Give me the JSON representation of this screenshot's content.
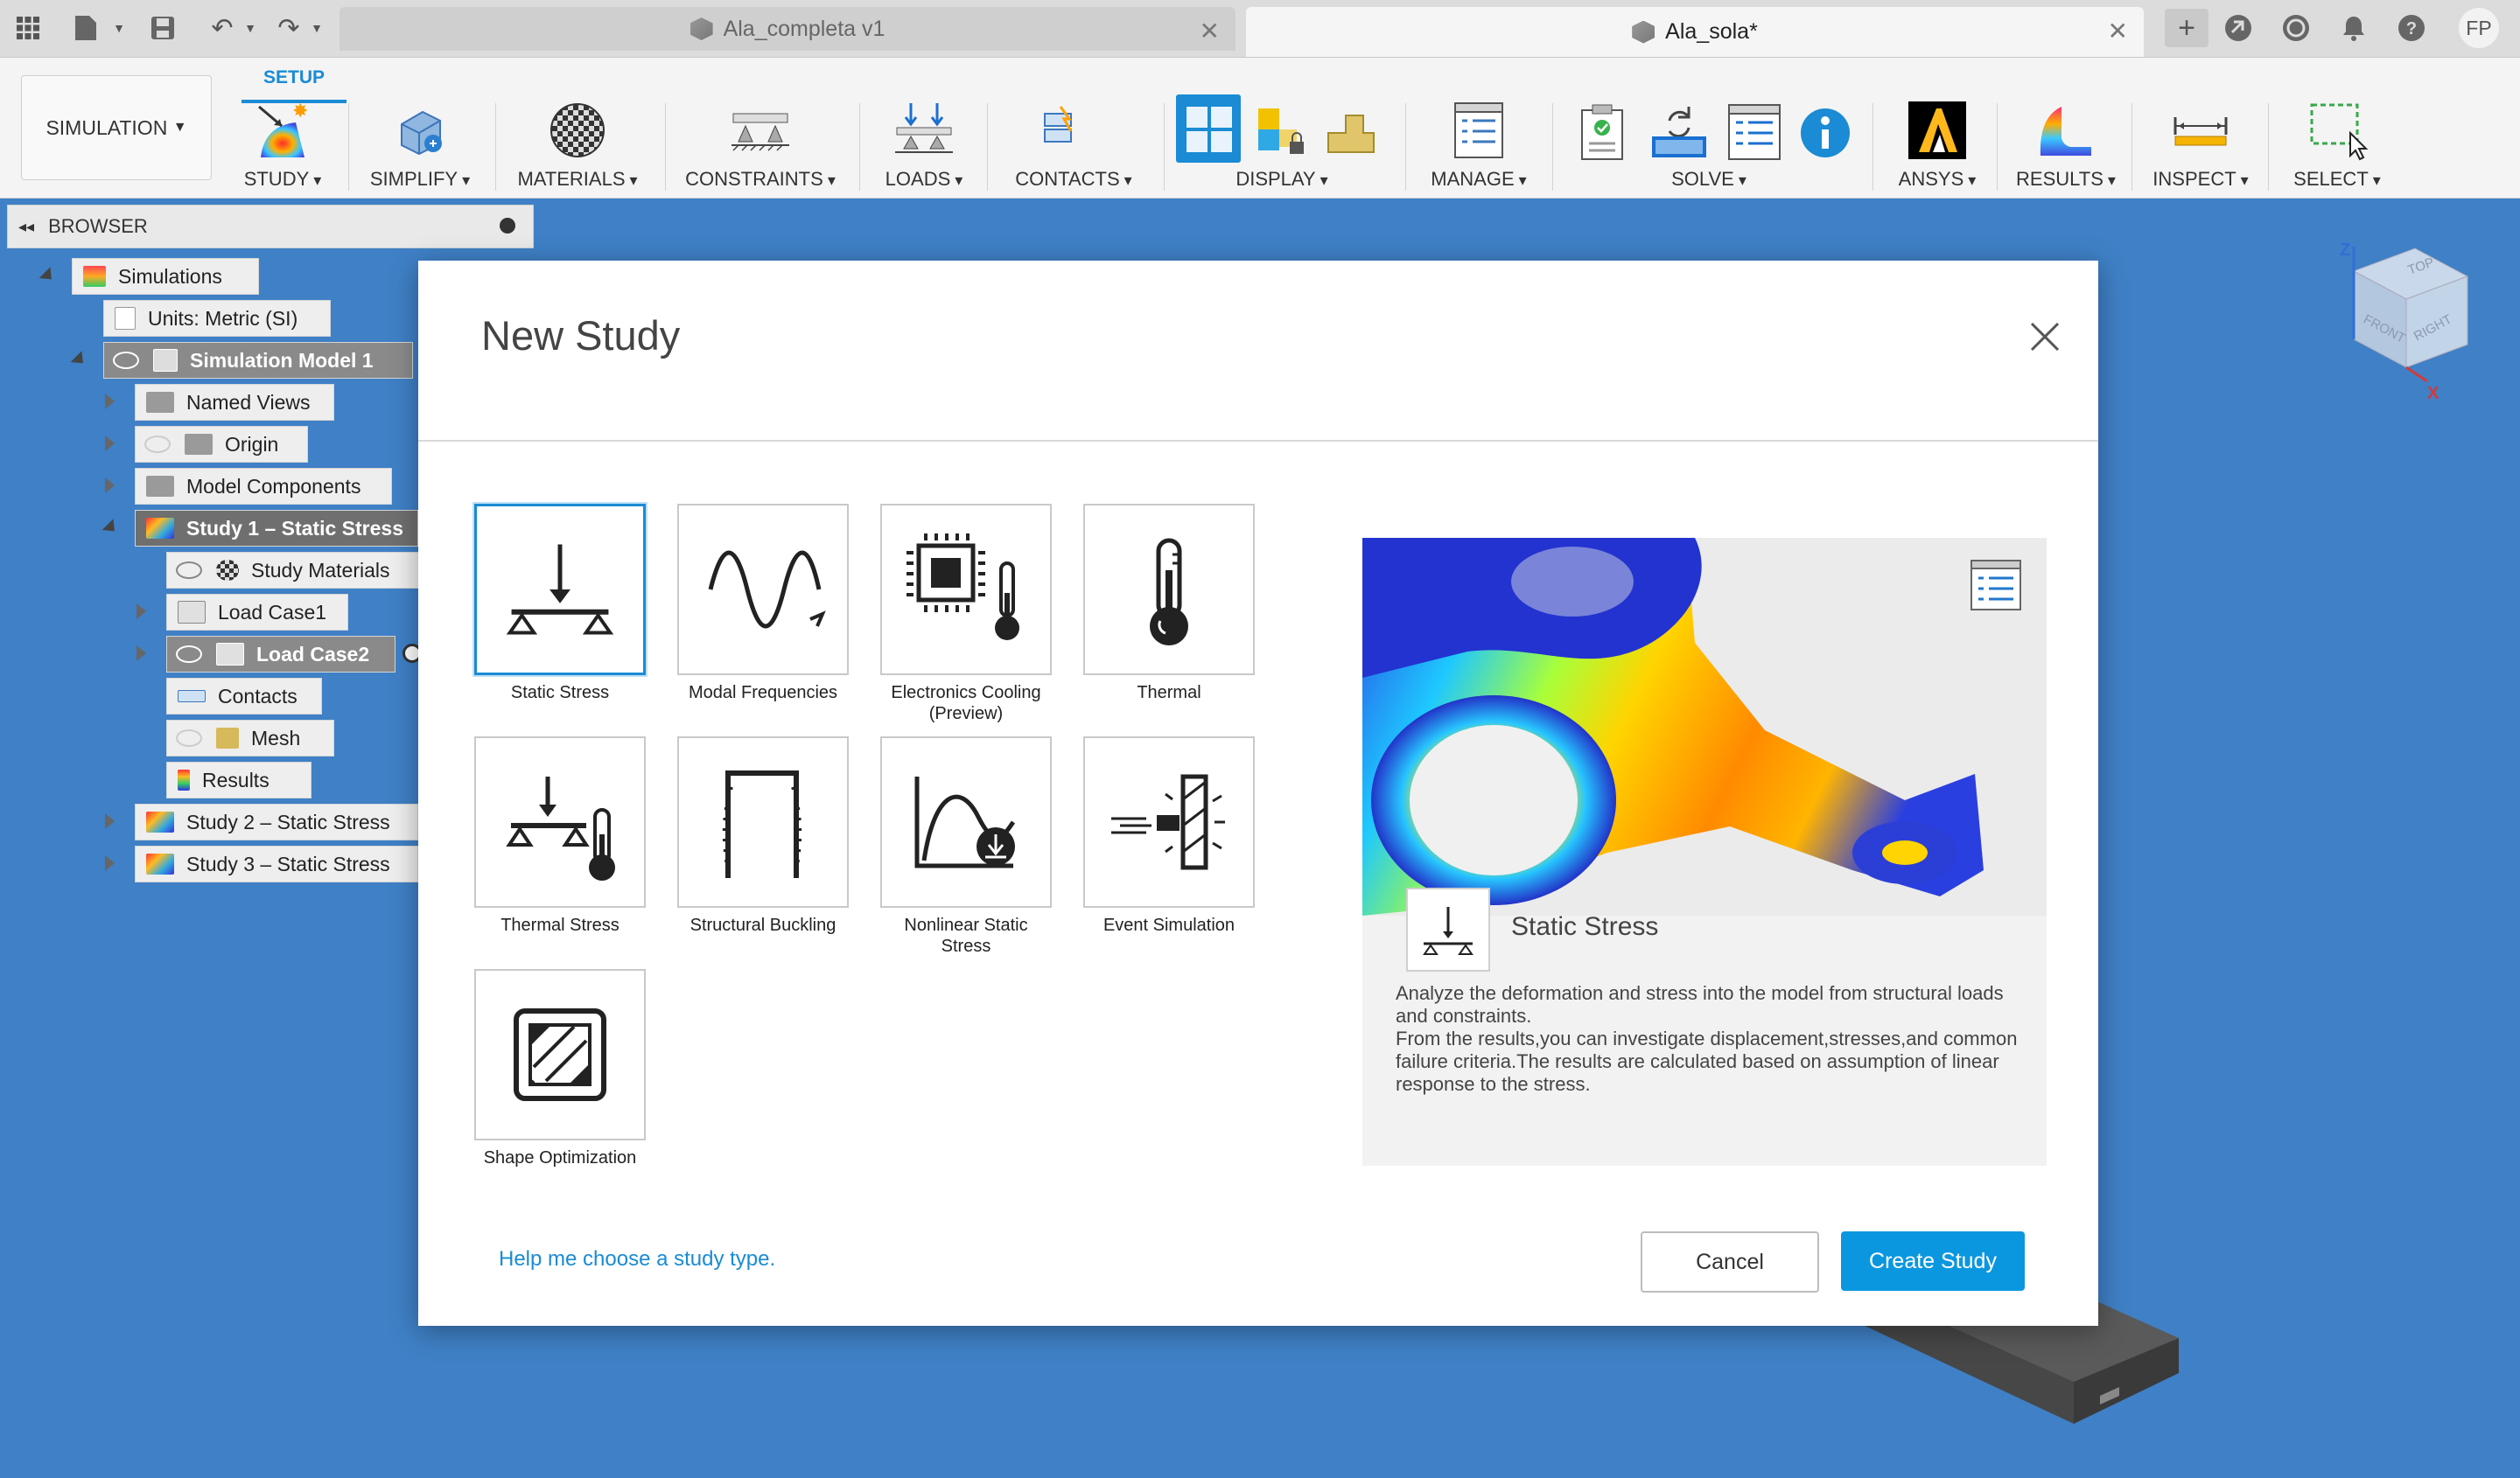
{
  "tabs": [
    {
      "label": "Ala_completa v1",
      "active": false
    },
    {
      "label": "Ala_sola*",
      "active": true
    }
  ],
  "user_initials": "FP",
  "workspace": "SIMULATION",
  "ribbon_tab": "SETUP",
  "ribbon_groups": [
    "STUDY",
    "SIMPLIFY",
    "MATERIALS",
    "CONSTRAINTS",
    "LOADS",
    "CONTACTS",
    "DISPLAY",
    "MANAGE",
    "SOLVE",
    "ANSYS",
    "RESULTS",
    "INSPECT",
    "SELECT"
  ],
  "browser": {
    "title": "BROWSER",
    "nodes": {
      "simulations": "Simulations",
      "units": "Units: Metric (SI)",
      "model": "Simulation Model 1",
      "named_views": "Named Views",
      "origin": "Origin",
      "model_components": "Model Components",
      "study1": "Study 1 – Static Stress",
      "study_materials": "Study Materials",
      "load_case1": "Load Case1",
      "load_case2": "Load Case2",
      "contacts": "Contacts",
      "mesh": "Mesh",
      "results": "Results",
      "study2": "Study 2 – Static Stress",
      "study3": "Study 3 – Static Stress"
    }
  },
  "viewcube": {
    "top": "TOP",
    "front": "FRONT",
    "right": "RIGHT",
    "z": "Z",
    "x": "X"
  },
  "dialog": {
    "title": "New Study",
    "study_types": [
      {
        "label": "Static Stress",
        "selected": true,
        "icon": "static-stress-icon"
      },
      {
        "label": "Modal Frequencies",
        "icon": "modal-frequencies-icon"
      },
      {
        "label": "Electronics Cooling (Preview)",
        "icon": "electronics-cooling-icon"
      },
      {
        "label": "Thermal",
        "icon": "thermal-icon"
      },
      {
        "label": "Thermal Stress",
        "icon": "thermal-stress-icon"
      },
      {
        "label": "Structural Buckling",
        "icon": "structural-buckling-icon"
      },
      {
        "label": "Nonlinear Static Stress",
        "icon": "nonlinear-static-stress-icon"
      },
      {
        "label": "Event Simulation",
        "icon": "event-simulation-icon"
      },
      {
        "label": "Shape Optimization",
        "icon": "shape-optimization-icon"
      }
    ],
    "preview": {
      "name": "Static Stress",
      "description_1": "Analyze the deformation and stress into the model from structural loads and constraints.",
      "description_2": "From the results,you can investigate displacement,stresses,and common failure criteria.The results are calculated based on assumption of linear response to the stress."
    },
    "help_link": "Help me choose a study type.",
    "cancel": "Cancel",
    "create": "Create Study"
  }
}
